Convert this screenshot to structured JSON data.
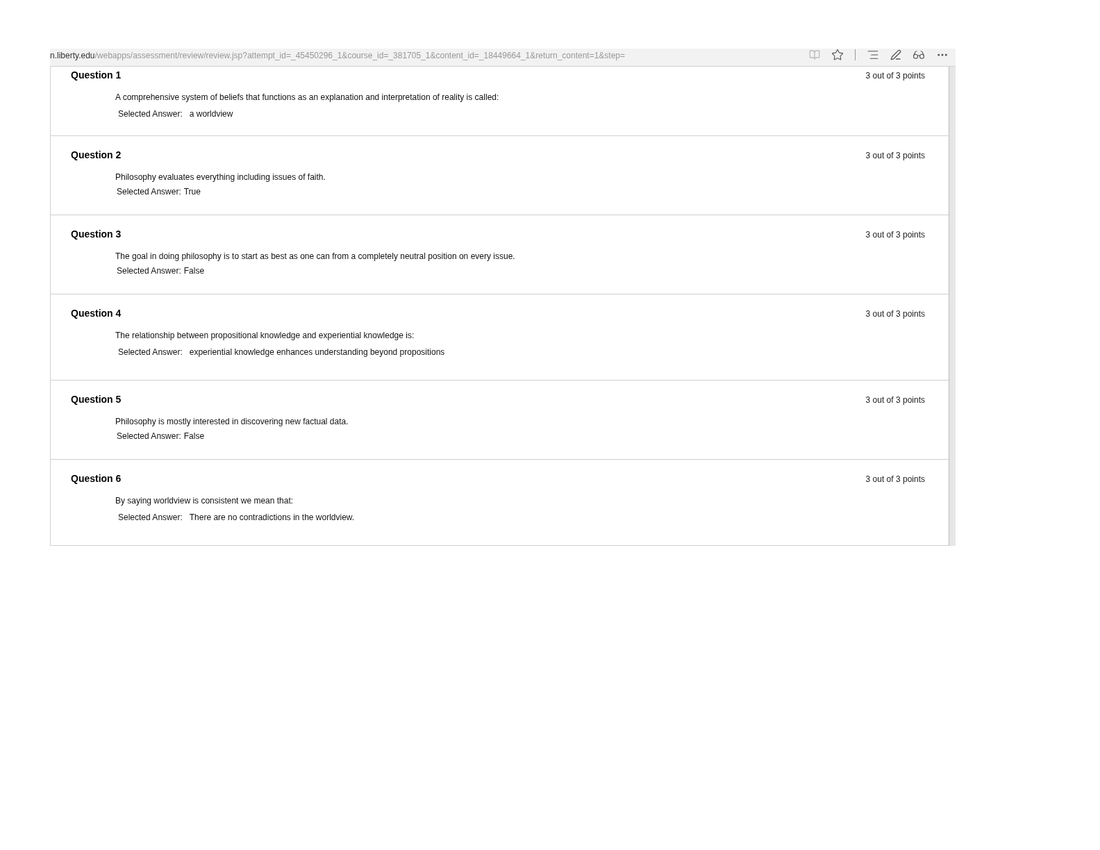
{
  "address_bar": {
    "domain": "n.liberty.edu",
    "path": "/webapps/assessment/review/review.jsp?attempt_id=_45450296_1&course_id=_381705_1&content_id=_18449664_1&return_content=1&step="
  },
  "questions": [
    {
      "title": "Question 1",
      "score": "3 out of 3 points",
      "text": "A comprehensive system of beliefs that functions as an explanation and interpretation of reality is called:",
      "answer_label": "Selected Answer:",
      "answer": "a worldview",
      "kind": "table"
    },
    {
      "title": "Question 2",
      "score": "3 out of 3 points",
      "text": "Philosophy evaluates everything including issues of faith.",
      "answer_label": "Selected Answer:",
      "answer": "True",
      "kind": "inline"
    },
    {
      "title": "Question 3",
      "score": "3 out of 3 points",
      "text": "The goal in doing philosophy is to start as best as one can from a completely neutral position on every issue.",
      "answer_label": "Selected Answer:",
      "answer": "False",
      "kind": "inline"
    },
    {
      "title": "Question 4",
      "score": "3 out of 3 points",
      "text": "The relationship between propositional knowledge and experiential knowledge is:",
      "answer_label": "Selected Answer:",
      "answer": "experiential knowledge enhances understanding beyond propositions",
      "kind": "table"
    },
    {
      "title": "Question 5",
      "score": "3 out of 3 points",
      "text": "Philosophy is mostly interested in discovering new factual data.",
      "answer_label": "Selected Answer:",
      "answer": "False",
      "kind": "inline"
    },
    {
      "title": "Question 6",
      "score": "3 out of 3 points",
      "text": "By saying worldview is consistent we mean that:",
      "answer_label": "Selected Answer:",
      "answer": "There are no contradictions in the worldview.",
      "kind": "table"
    }
  ]
}
